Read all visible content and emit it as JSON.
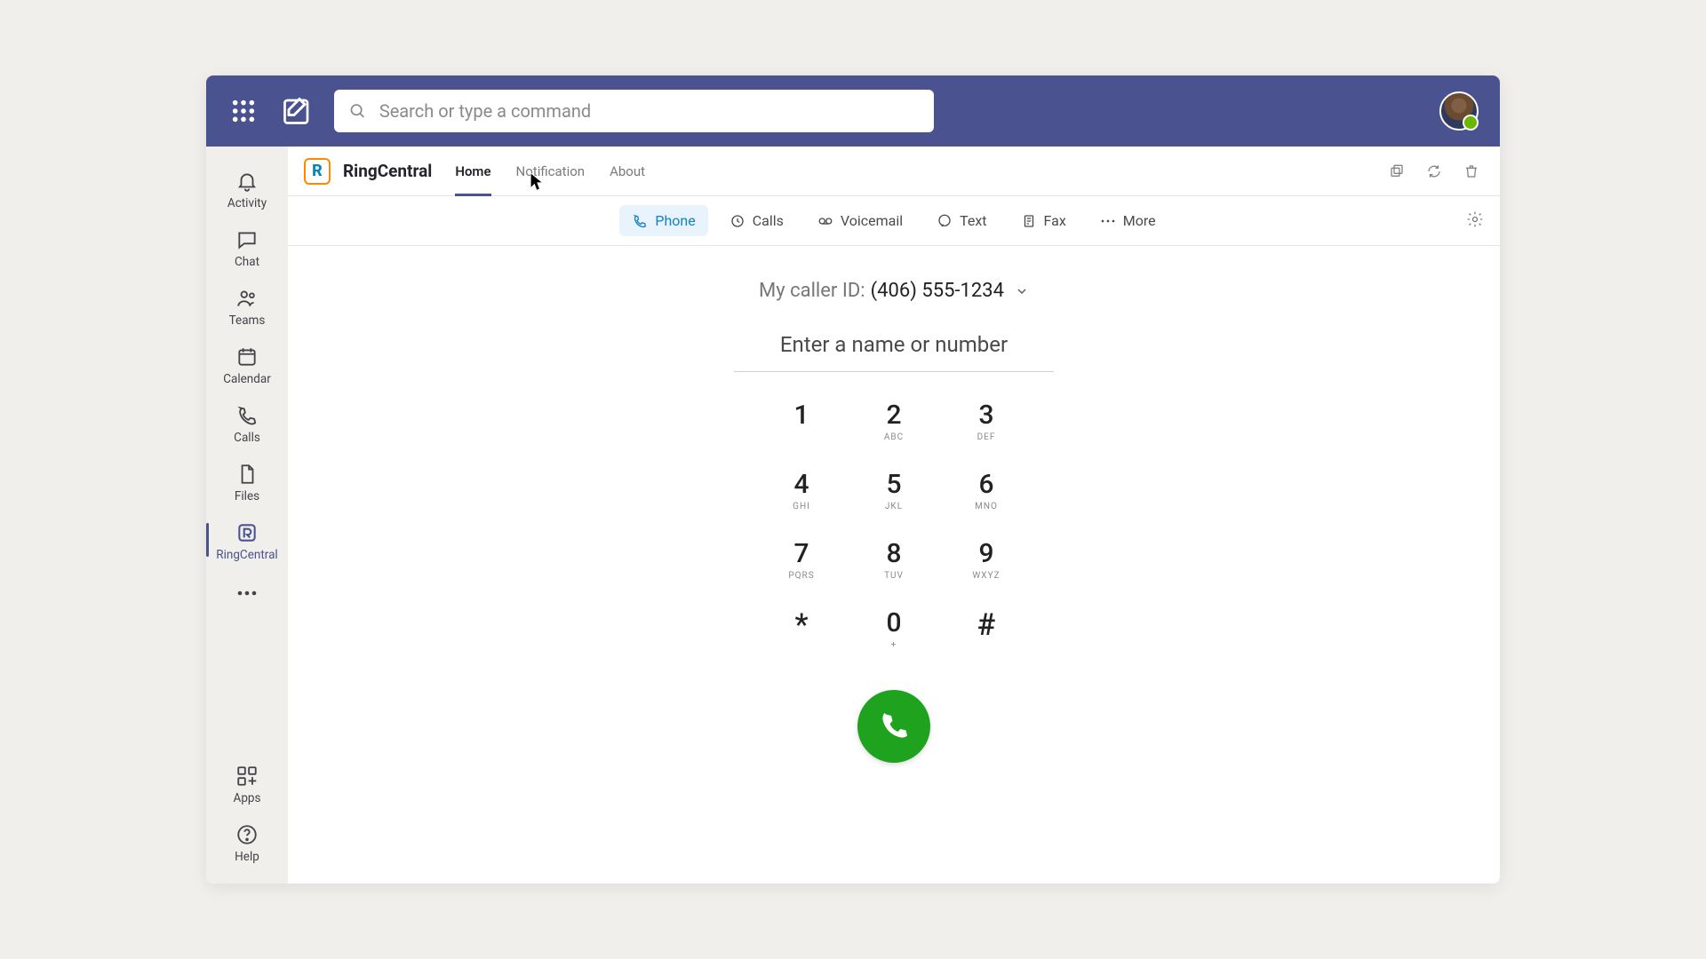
{
  "colors": {
    "titlebar": "#4a5390",
    "accent_blue": "#1081c8",
    "rc_orange": "#ff8800",
    "call_green": "#1fa31f"
  },
  "header": {
    "search_placeholder": "Search or type a command"
  },
  "rail": {
    "items": [
      {
        "id": "activity",
        "label": "Activity"
      },
      {
        "id": "chat",
        "label": "Chat"
      },
      {
        "id": "teams",
        "label": "Teams"
      },
      {
        "id": "calendar",
        "label": "Calendar"
      },
      {
        "id": "calls",
        "label": "Calls"
      },
      {
        "id": "files",
        "label": "Files"
      },
      {
        "id": "ringcentral",
        "label": "RingCentral"
      }
    ],
    "apps_label": "Apps",
    "help_label": "Help"
  },
  "app": {
    "logo_letter": "R",
    "title": "RingCentral",
    "tabs": [
      "Home",
      "Notification",
      "About"
    ],
    "active_tab": 0
  },
  "subtabs": {
    "items": [
      {
        "id": "phone",
        "label": "Phone"
      },
      {
        "id": "calls",
        "label": "Calls"
      },
      {
        "id": "voicemail",
        "label": "Voicemail"
      },
      {
        "id": "text",
        "label": "Text"
      },
      {
        "id": "fax",
        "label": "Fax"
      },
      {
        "id": "more",
        "label": "More"
      }
    ],
    "active": 0
  },
  "dialer": {
    "caller_id_label": "My caller ID: ",
    "caller_id_number": "(406) 555-1234",
    "input_placeholder": "Enter a name or number",
    "keys": [
      {
        "digit": "1",
        "letters": ""
      },
      {
        "digit": "2",
        "letters": "ABC"
      },
      {
        "digit": "3",
        "letters": "DEF"
      },
      {
        "digit": "4",
        "letters": "GHI"
      },
      {
        "digit": "5",
        "letters": "JKL"
      },
      {
        "digit": "6",
        "letters": "MNO"
      },
      {
        "digit": "7",
        "letters": "PQRS"
      },
      {
        "digit": "8",
        "letters": "TUV"
      },
      {
        "digit": "9",
        "letters": "WXYZ"
      },
      {
        "digit": "*",
        "letters": ""
      },
      {
        "digit": "0",
        "letters": "+"
      },
      {
        "digit": "#",
        "letters": ""
      }
    ]
  }
}
